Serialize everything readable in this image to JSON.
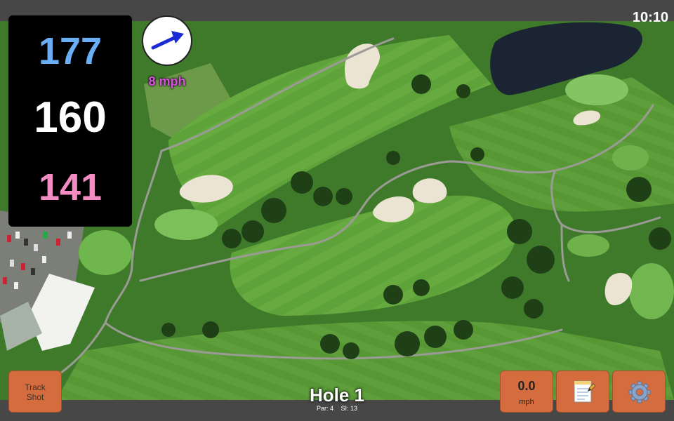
{
  "status": {
    "time": "10:10"
  },
  "distances": {
    "back": "177",
    "middle": "160",
    "front": "141"
  },
  "wind": {
    "speed_label": "8 mph",
    "direction_icon": "arrow-right-icon"
  },
  "toolbar": {
    "track_shot_line1": "Track",
    "track_shot_line2": "Shot",
    "wind_value": "0.0",
    "wind_unit": "mph",
    "notes_icon": "notepad-icon",
    "settings_icon": "gear-icon"
  },
  "hole": {
    "title": "Hole 1",
    "par_label": "Par: 4",
    "si_label": "SI: 13"
  },
  "colors": {
    "back_distance": "#6aaef5",
    "middle_distance": "#ffffff",
    "front_distance": "#f48cc4",
    "wind_text": "#d84fe0",
    "button": "#d46c3e",
    "arrow": "#1a2bd6",
    "bars": "#474747"
  }
}
